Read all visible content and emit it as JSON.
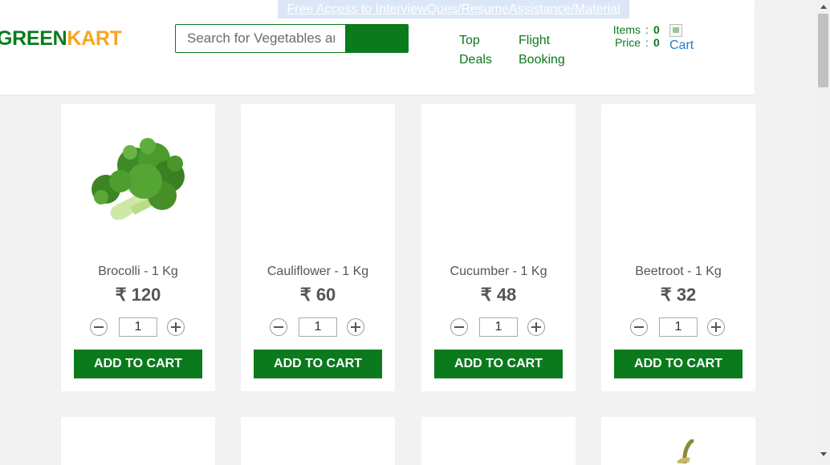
{
  "header": {
    "promo_link": "Free Access to InterviewQues/ResumeAssistance/Material",
    "logo": {
      "part1": "GREEN",
      "part2": "KART"
    },
    "search": {
      "placeholder": "Search for Vegetables and Fruits"
    },
    "nav": [
      {
        "line1": "Top",
        "line2": "Deals"
      },
      {
        "line1": "Flight",
        "line2": "Booking"
      }
    ],
    "cart_info": {
      "items_label": "Items",
      "items_value": "0",
      "price_label": "Price",
      "price_value": "0",
      "separator": ":"
    },
    "cart_link": "Cart"
  },
  "products": [
    {
      "name": "Brocolli - 1 Kg",
      "price": "₹ 120",
      "quantity": "1",
      "button": "ADD TO CART",
      "image": "broccoli"
    },
    {
      "name": "Cauliflower - 1 Kg",
      "price": "₹ 60",
      "quantity": "1",
      "button": "ADD TO CART",
      "image": ""
    },
    {
      "name": "Cucumber - 1 Kg",
      "price": "₹ 48",
      "quantity": "1",
      "button": "ADD TO CART",
      "image": ""
    },
    {
      "name": "Beetroot - 1 Kg",
      "price": "₹ 32",
      "quantity": "1",
      "button": "ADD TO CART",
      "image": ""
    }
  ],
  "colors": {
    "brand_green": "#0a7a1c",
    "brand_orange": "#f5a623",
    "link_blue": "#1b7fd0"
  }
}
